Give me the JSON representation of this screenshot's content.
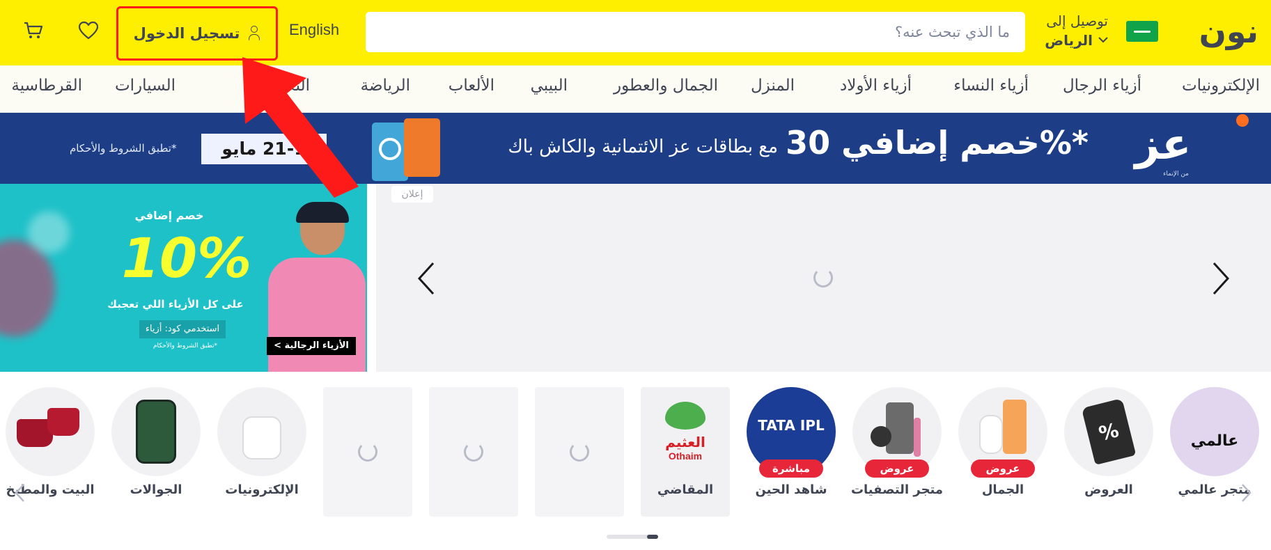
{
  "header": {
    "logo_text": "نون",
    "deliver_label": "توصيل إلى",
    "deliver_city": "الرياض",
    "search_placeholder": "ما الذي تبحث عنه؟",
    "language_link": "English",
    "signin_label": "تسجيل الدخول",
    "icons": [
      "flag-icon",
      "chevron-down-icon",
      "user-icon",
      "heart-icon",
      "cart-icon"
    ]
  },
  "nav": {
    "items": [
      "الإلكترونيات",
      "أزياء الرجال",
      "أزياء النساء",
      "أزياء الأولاد",
      "المنزل",
      "الجمال والعطور",
      "البيبي",
      "الألعاب",
      "الرياضة",
      "التغذية",
      "السيارات",
      "القرطاسية"
    ]
  },
  "promo_strip": {
    "logo_text": "عز",
    "logo_sub": "من الإنماء",
    "headline": "خصم إضافي 30%*",
    "tagline": "مع بطاقات عز الائتمانية والكاش باك",
    "date": "21-1 مايو",
    "terms": "*تطبق الشروط والأحكام"
  },
  "fashion_banner": {
    "top_text": "خصم إضافي",
    "big_text": "10%",
    "subtitle": "على كل الأزياء اللي تعجبك",
    "code_text": "استخدمي كود: أزياء",
    "terms": "*تطبق الشروط والأحكام",
    "cta": "الأزياء الرجالية >"
  },
  "main_banner": {
    "ad_label": "إعلان"
  },
  "categories": [
    {
      "label": "متجر عالمي",
      "image_text": "عالمي"
    },
    {
      "label": "العروض",
      "image_text": "%"
    },
    {
      "label": "الجمال",
      "badge": "عروض"
    },
    {
      "label": "متجر التصفيات",
      "badge": "عروض"
    },
    {
      "label": "شاهد الحين",
      "badge": "مباشرة",
      "image_text": "TATA IPL"
    },
    {
      "label": "المقاضي",
      "image_text": "العثيم",
      "image_text_en": "Othaim"
    },
    {
      "label": "الإلكترونيات"
    },
    {
      "label": "الجوالات"
    },
    {
      "label": "البيت والمطبخ"
    }
  ],
  "colors": {
    "brand_yellow": "#feee00",
    "strip_blue": "#1d3e86",
    "badge_red": "#e8263a",
    "annotation_red": "#ff1a1a"
  }
}
